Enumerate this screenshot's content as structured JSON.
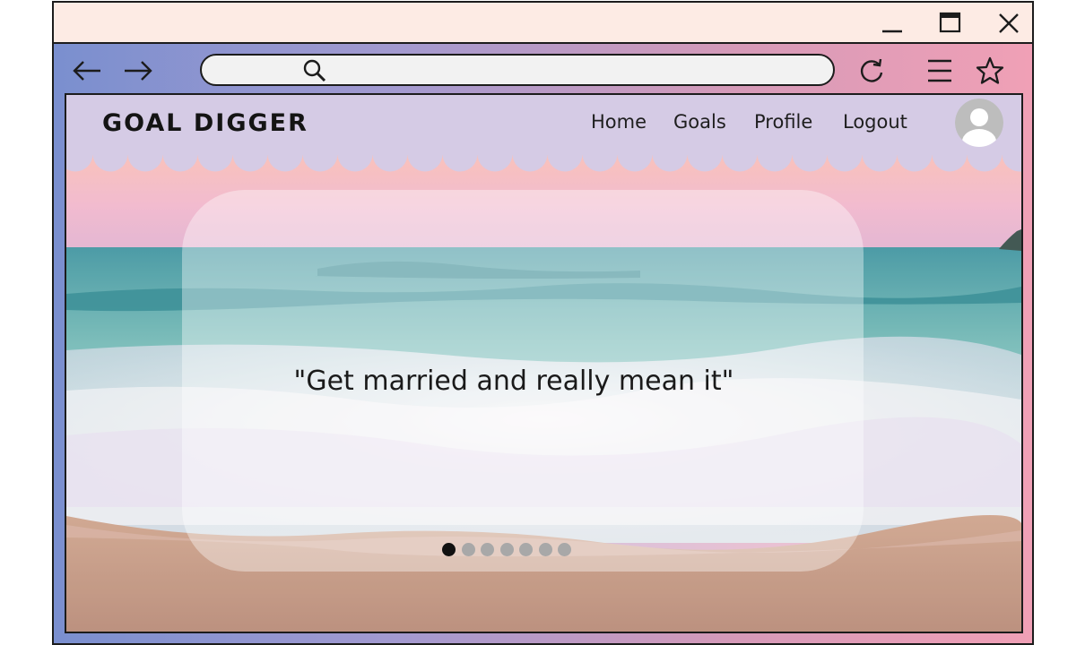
{
  "window": {
    "controls": [
      "minimize",
      "maximize",
      "close"
    ]
  },
  "browser": {
    "address_placeholder": "",
    "address_value": ""
  },
  "site": {
    "brand": "GOAL DIGGER",
    "nav": [
      {
        "label": "Home"
      },
      {
        "label": "Goals"
      },
      {
        "label": "Profile"
      },
      {
        "label": "Logout"
      }
    ]
  },
  "hero": {
    "quote": "\"Get married and really mean it\"",
    "slide_count": 7,
    "active_slide": 1
  },
  "colors": {
    "titlebar": "#fdebe4",
    "header": "#d5cbe5",
    "chrome_start": "#7a8fcf",
    "chrome_end": "#f0a0b6",
    "dot_active": "#111111",
    "dot_inactive": "#a8a8a8"
  },
  "icons": {
    "back": "arrow-left-icon",
    "forward": "arrow-right-icon",
    "search": "search-icon",
    "reload": "reload-icon",
    "menu": "hamburger-menu-icon",
    "bookmark": "star-icon",
    "avatar": "user-avatar-icon"
  }
}
